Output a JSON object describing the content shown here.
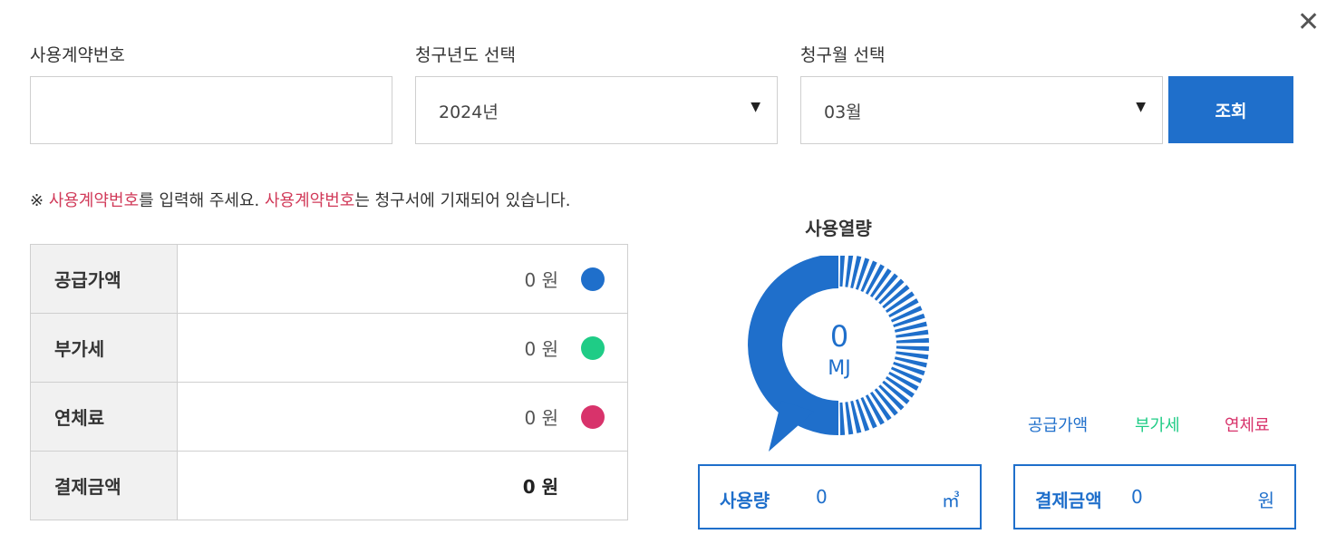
{
  "form": {
    "contract_label": "사용계약번호",
    "contract_value": "",
    "year_label": "청구년도 선택",
    "year_value": "2024년",
    "month_label": "청구월 선택",
    "month_value": "03월",
    "search_label": "조회",
    "close_symbol": "✕"
  },
  "notice": {
    "prefix": "※ ",
    "em1": "사용계약번호",
    "mid": "를 입력해 주세요. ",
    "em2": "사용계약번호",
    "suffix": "는 청구서에 기재되어 있습니다."
  },
  "fees": [
    {
      "label": "공급가액",
      "value": "0 원",
      "color": "#1f6fcb"
    },
    {
      "label": "부가세",
      "value": "0 원",
      "color": "#1fcc86"
    },
    {
      "label": "연체료",
      "value": "0 원",
      "color": "#d8336b"
    },
    {
      "label": "결제금액",
      "value": "0 원"
    }
  ],
  "gauge": {
    "title": "사용열량",
    "value": "0",
    "unit": "MJ",
    "fill_fraction": 0.5
  },
  "legend": [
    {
      "label": "공급가액",
      "color": "#1f6fcb"
    },
    {
      "label": "부가세",
      "color": "#1fcc86"
    },
    {
      "label": "연체료",
      "color": "#d8336b"
    }
  ],
  "usage_box": {
    "label": "사용량",
    "value": "0",
    "unit": "㎥"
  },
  "payment_box": {
    "label": "결제금액",
    "value": "0",
    "unit": "원"
  },
  "colors": {
    "accent": "#1f6fcb",
    "alert": "#d13a59"
  }
}
